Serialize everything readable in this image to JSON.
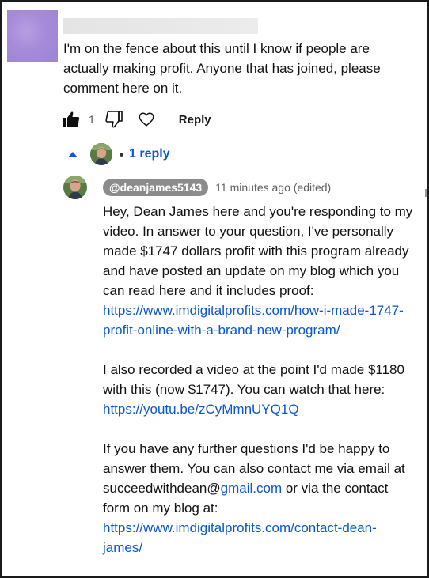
{
  "comment": {
    "text": "I'm on the fence about this until I know if people are\nactually making profit.  Anyone that has joined, please\ncomment here on it.",
    "like_count": "1",
    "reply_label": "Reply"
  },
  "replies": {
    "count_label": "1 reply"
  },
  "reply": {
    "author": "@deanjames5143",
    "time": "11 minutes ago (edited)",
    "p1_text": "Hey, Dean James here and you're responding to my video. In answer to your question, I've personally made $1747 dollars profit with this program already and have posted an update on my blog which you can read here and it includes proof: ",
    "p1_link": "https://www.imdigitalprofits.com/how-i-made-1747-profit-online-with-a-brand-new-program/",
    "p2_text": "I also recorded a video at the point I'd made $1180 with this (now $1747). You can watch that here: ",
    "p2_link": "https://youtu.be/zCyMmnUYQ1Q",
    "p3_text_a": "If you have any further questions I'd be happy to answer them. You can also contact me via email at succeedwithdean@",
    "p3_email_link": "gmail.com",
    "p3_text_b": " or via the contact form on my blog at: ",
    "p3_link": "https://www.imdigitalprofits.com/contact-dean-james/"
  },
  "colors": {
    "link": "#0b57d0",
    "author_chip": "#8c8c8c",
    "top_avatar": "#a58ad8"
  },
  "icons": {
    "like": "thumbs-up-icon",
    "dislike": "thumbs-down-icon",
    "heart": "heart-icon",
    "collapse": "chevron-up-icon"
  }
}
